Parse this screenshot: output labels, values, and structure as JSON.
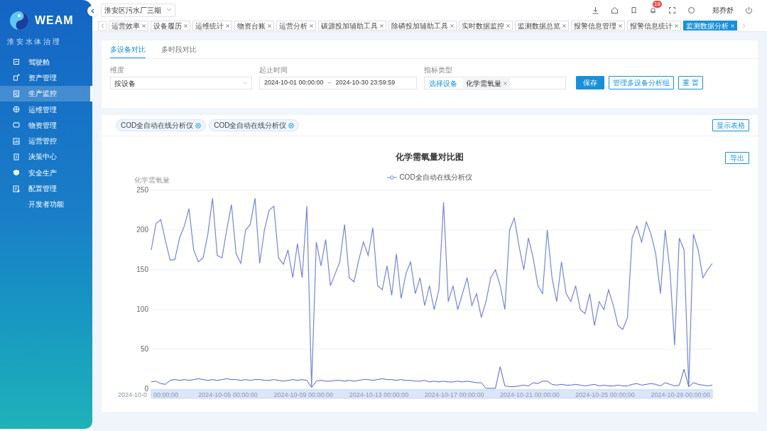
{
  "sidebar": {
    "logo": "WEAM",
    "subtitle": "淮 安 水 体 治 理",
    "items": [
      {
        "label": "驾驶舱",
        "selected": false
      },
      {
        "label": "资产管理",
        "selected": false
      },
      {
        "label": "生产监控",
        "selected": true
      },
      {
        "label": "运维管理",
        "selected": false
      },
      {
        "label": "物资管理",
        "selected": false
      },
      {
        "label": "运营管控",
        "selected": false
      },
      {
        "label": "决策中心",
        "selected": false
      },
      {
        "label": "安全生产",
        "selected": false
      },
      {
        "label": "配置管理",
        "selected": false
      },
      {
        "label": "开发者功能",
        "selected": false
      }
    ]
  },
  "header": {
    "plant_select": "淮安区污水厂三期",
    "notification_count": "16",
    "user": "郑乔舒"
  },
  "tabs": [
    {
      "label": "运营效率",
      "selected": false
    },
    {
      "label": "设备履历",
      "selected": false
    },
    {
      "label": "运维统计",
      "selected": false
    },
    {
      "label": "物资台账",
      "selected": false
    },
    {
      "label": "运营分析",
      "selected": false
    },
    {
      "label": "碳源投加辅助工具",
      "selected": false
    },
    {
      "label": "除磷投加辅助工具",
      "selected": false
    },
    {
      "label": "实时数据监控",
      "selected": false
    },
    {
      "label": "监测数据总览",
      "selected": false
    },
    {
      "label": "报警信息管理",
      "selected": false
    },
    {
      "label": "报警信息统计",
      "selected": false
    },
    {
      "label": "监测数据分析",
      "selected": true
    }
  ],
  "filter": {
    "subtabs": [
      {
        "label": "多设备对比",
        "selected": true
      },
      {
        "label": "多时段对比",
        "selected": false
      }
    ],
    "dimension": {
      "label": "维度",
      "value": "按设备"
    },
    "time_range": {
      "label": "起止时间",
      "start": "2024-10-01 00:00:00",
      "separator": "–",
      "end": "2024-10-30 23:59:59"
    },
    "indicator": {
      "label": "指标类型",
      "link": "选择设备",
      "tags": [
        "化学需氧量"
      ]
    },
    "buttons": [
      {
        "label": "保存",
        "kind": "primary"
      },
      {
        "label": "管理多设备分析组",
        "kind": "outline"
      },
      {
        "label": "重 置",
        "kind": "outline"
      }
    ]
  },
  "chart_panel": {
    "devices": [
      "COD全自动在线分析仪",
      "COD全自动在线分析仪"
    ],
    "show_table_button": "显示表格",
    "export_button": "导出",
    "slider_labels": [
      "2024-10-0",
      "00:00:00",
      "2024-10-05 00:00:00",
      "2024-10-09 00:00:00",
      "2024-10-13 00:00:00",
      "2024-10-17 00:00:00",
      "2024-10-21 00:00:00",
      "2024-10-25 00:00:00",
      "2024-10-29 00:00:00"
    ],
    "chart_data": {
      "type": "line",
      "title": "化学需氧量对比图",
      "ylabel": "化学需氧量",
      "ylim": [
        0,
        250
      ],
      "grid": true,
      "yticks": [
        0,
        50,
        100,
        150,
        200,
        250
      ],
      "series": [
        {
          "name": "COD全自动在线分析仪",
          "color": "#7486d6",
          "values": [
            175,
            208,
            213,
            187,
            162,
            163,
            190,
            205,
            227,
            175,
            160,
            165,
            195,
            240,
            168,
            165,
            200,
            232,
            170,
            158,
            200,
            207,
            240,
            158,
            200,
            225,
            230,
            165,
            157,
            175,
            140,
            183,
            140,
            230,
            3,
            185,
            155,
            188,
            130,
            145,
            160,
            207,
            140,
            135,
            162,
            185,
            168,
            203,
            130,
            125,
            155,
            118,
            170,
            114,
            145,
            160,
            120,
            140,
            105,
            130,
            100,
            125,
            235,
            110,
            130,
            100,
            120,
            140,
            105,
            120,
            90,
            110,
            140,
            150,
            130,
            100,
            200,
            215,
            180,
            150,
            190,
            165,
            130,
            120,
            200,
            140,
            110,
            160,
            120,
            110,
            130,
            100,
            95,
            120,
            80,
            110,
            100,
            125,
            105,
            80,
            75,
            90,
            190,
            205,
            185,
            210,
            195,
            170,
            120,
            200,
            150,
            55,
            190,
            175,
            3,
            195,
            175,
            140,
            150,
            158
          ]
        },
        {
          "color": "#4f63c6",
          "values": [
            9,
            10,
            7,
            6,
            11,
            12,
            11,
            12,
            11,
            12,
            13,
            12,
            11,
            12,
            11,
            12,
            13,
            12,
            12,
            11,
            12,
            11,
            12,
            12,
            11,
            11,
            12,
            11,
            10,
            11,
            12,
            11,
            12,
            11,
            2,
            10,
            11,
            10,
            10,
            11,
            11,
            10,
            11,
            10,
            11,
            12,
            12,
            11,
            12,
            13,
            12,
            12,
            11,
            12,
            11,
            11,
            10,
            10,
            11,
            9,
            10,
            9,
            10,
            9,
            9,
            10,
            9,
            10,
            9,
            8,
            8,
            1,
            1,
            1,
            28,
            4,
            3,
            3,
            4,
            5,
            4,
            8,
            7,
            10,
            10,
            6,
            5,
            6,
            5,
            5,
            6,
            5,
            4,
            5,
            6,
            4,
            5,
            4,
            4,
            5,
            4,
            4,
            6,
            7,
            5,
            6,
            7,
            6,
            4,
            8,
            6,
            4,
            5,
            25,
            3,
            8,
            6,
            5,
            4,
            5
          ]
        }
      ]
    }
  }
}
